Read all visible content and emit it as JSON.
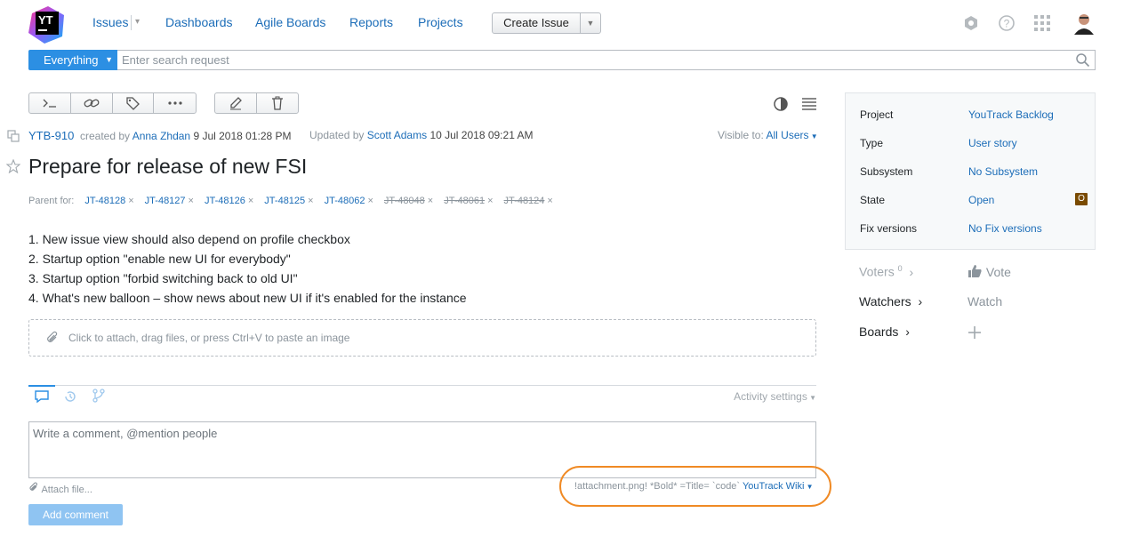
{
  "logo": {
    "text": "YT"
  },
  "nav": {
    "issues": "Issues",
    "dashboards": "Dashboards",
    "agile_boards": "Agile Boards",
    "reports": "Reports",
    "projects": "Projects",
    "create_issue": "Create Issue"
  },
  "search": {
    "scope": "Everything",
    "placeholder": "Enter search request"
  },
  "issue": {
    "id": "YTB-910",
    "created_by_label": "created by",
    "creator": "Anna Zhdan",
    "created_date": "9 Jul 2018 01:28 PM",
    "updated_by_label": "Updated by",
    "updater": "Scott Adams",
    "updated_date": "10 Jul 2018 09:21 AM",
    "visible_label": "Visible to:",
    "visible_value": "All Users",
    "title": "Prepare for release of new FSI",
    "parent_label": "Parent for:",
    "parents": [
      {
        "id": "JT-48128",
        "resolved": false
      },
      {
        "id": "JT-48127",
        "resolved": false
      },
      {
        "id": "JT-48126",
        "resolved": false
      },
      {
        "id": "JT-48125",
        "resolved": false
      },
      {
        "id": "JT-48062",
        "resolved": false
      },
      {
        "id": "JT-48048",
        "resolved": true
      },
      {
        "id": "JT-48061",
        "resolved": true
      },
      {
        "id": "JT-48124",
        "resolved": true
      }
    ],
    "description": [
      "1. New issue view should also depend on profile checkbox",
      "2. Startup option \"enable new UI for everybody\"",
      "3. Startup option \"forbid switching back to old UI\"",
      "4. What's new balloon – show news about new UI if it's enabled for the instance"
    ],
    "attach_hint": "Click to attach, drag files, or press Ctrl+V to paste an image"
  },
  "activity": {
    "settings": "Activity settings"
  },
  "comment": {
    "placeholder": "Write a comment, @mention people",
    "attach_file": "Attach file...",
    "wiki_hint": "!attachment.png! *Bold* =Title= `code`",
    "wiki_mode": "YouTrack Wiki",
    "add_button": "Add comment"
  },
  "fields": [
    {
      "key": "Project",
      "value": "YouTrack Backlog"
    },
    {
      "key": "Type",
      "value": "User story"
    },
    {
      "key": "Subsystem",
      "value": "No Subsystem"
    },
    {
      "key": "State",
      "value": "Open",
      "badge": "O"
    },
    {
      "key": "Fix versions",
      "value": "No Fix versions"
    }
  ],
  "side": {
    "voters": "Voters",
    "voters_count": "0",
    "vote": "Vote",
    "watchers": "Watchers",
    "watch": "Watch",
    "boards": "Boards"
  },
  "colors": {
    "accent": "#2c8fe3",
    "link": "#1c6db8",
    "highlight": "#f08a24",
    "state_badge": "#7a4b00"
  }
}
